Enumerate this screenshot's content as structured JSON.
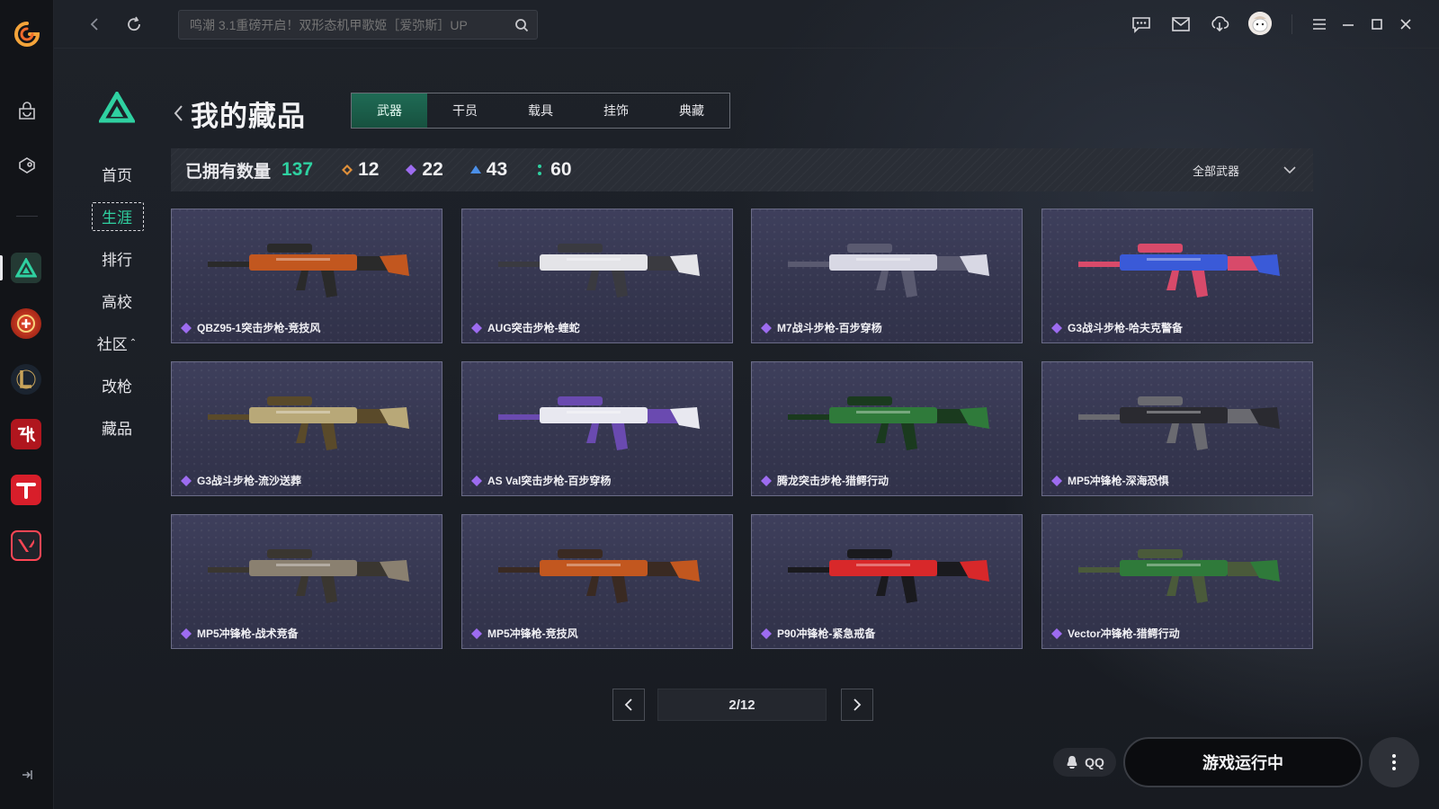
{
  "topbar": {
    "search_placeholder": "鸣潮 3.1重磅开启！双形态机甲歌姬［爱弥斯］UP",
    "icons": [
      "back-icon",
      "refresh-icon",
      "search-icon",
      "message-icon",
      "mail-icon",
      "download-icon",
      "avatar",
      "menu-icon",
      "minimize-icon",
      "maximize-icon",
      "close-icon"
    ]
  },
  "rail": {
    "icons": [
      "app-logo",
      "store-icon",
      "gift-icon",
      "delta-force-icon",
      "crossfire-icon",
      "league-of-legends-icon",
      "ni-shui-han-icon",
      "tiandao-icon",
      "valorant-icon",
      "collapse-icon"
    ]
  },
  "section_nav": {
    "items": [
      {
        "label": "首页"
      },
      {
        "label": "生涯"
      },
      {
        "label": "排行"
      },
      {
        "label": "高校"
      },
      {
        "label": "社区"
      },
      {
        "label": "改枪"
      },
      {
        "label": "藏品"
      }
    ],
    "active": "生涯"
  },
  "header": {
    "title": "我的藏品",
    "tabs": [
      "武器",
      "干员",
      "载具",
      "挂饰",
      "典藏"
    ],
    "active_tab": "武器"
  },
  "stats": {
    "label": "已拥有数量",
    "total": "137",
    "orange": "12",
    "purple": "22",
    "blue": "43",
    "green": "60",
    "filter": "全部武器"
  },
  "colors": {
    "accent": "#2fd1a1",
    "rarity_orange": "#e0903a",
    "rarity_purple": "#9d6cf0",
    "rarity_blue": "#4b8fe8",
    "rarity_green": "#2fd1a1"
  },
  "items": [
    {
      "name": "QBZ95-1突击步枪-竞技风"
    },
    {
      "name": "AUG突击步枪-蝰蛇"
    },
    {
      "name": "M7战斗步枪-百步穿杨"
    },
    {
      "name": "G3战斗步枪-哈夫克警备"
    },
    {
      "name": "G3战斗步枪-流沙送葬"
    },
    {
      "name": "AS Val突击步枪-百步穿杨"
    },
    {
      "name": "腾龙突击步枪-猎鳄行动"
    },
    {
      "name": "MP5冲锋枪-深海恐惧"
    },
    {
      "name": "MP5冲锋枪-战术竞备"
    },
    {
      "name": "MP5冲锋枪-竞技风"
    },
    {
      "name": "P90冲锋枪-紧急戒备"
    },
    {
      "name": "Vector冲锋枪-猎鳄行动"
    }
  ],
  "pagination": {
    "text": "2/12"
  },
  "bottom": {
    "qq": "QQ",
    "run": "游戏运行中"
  }
}
